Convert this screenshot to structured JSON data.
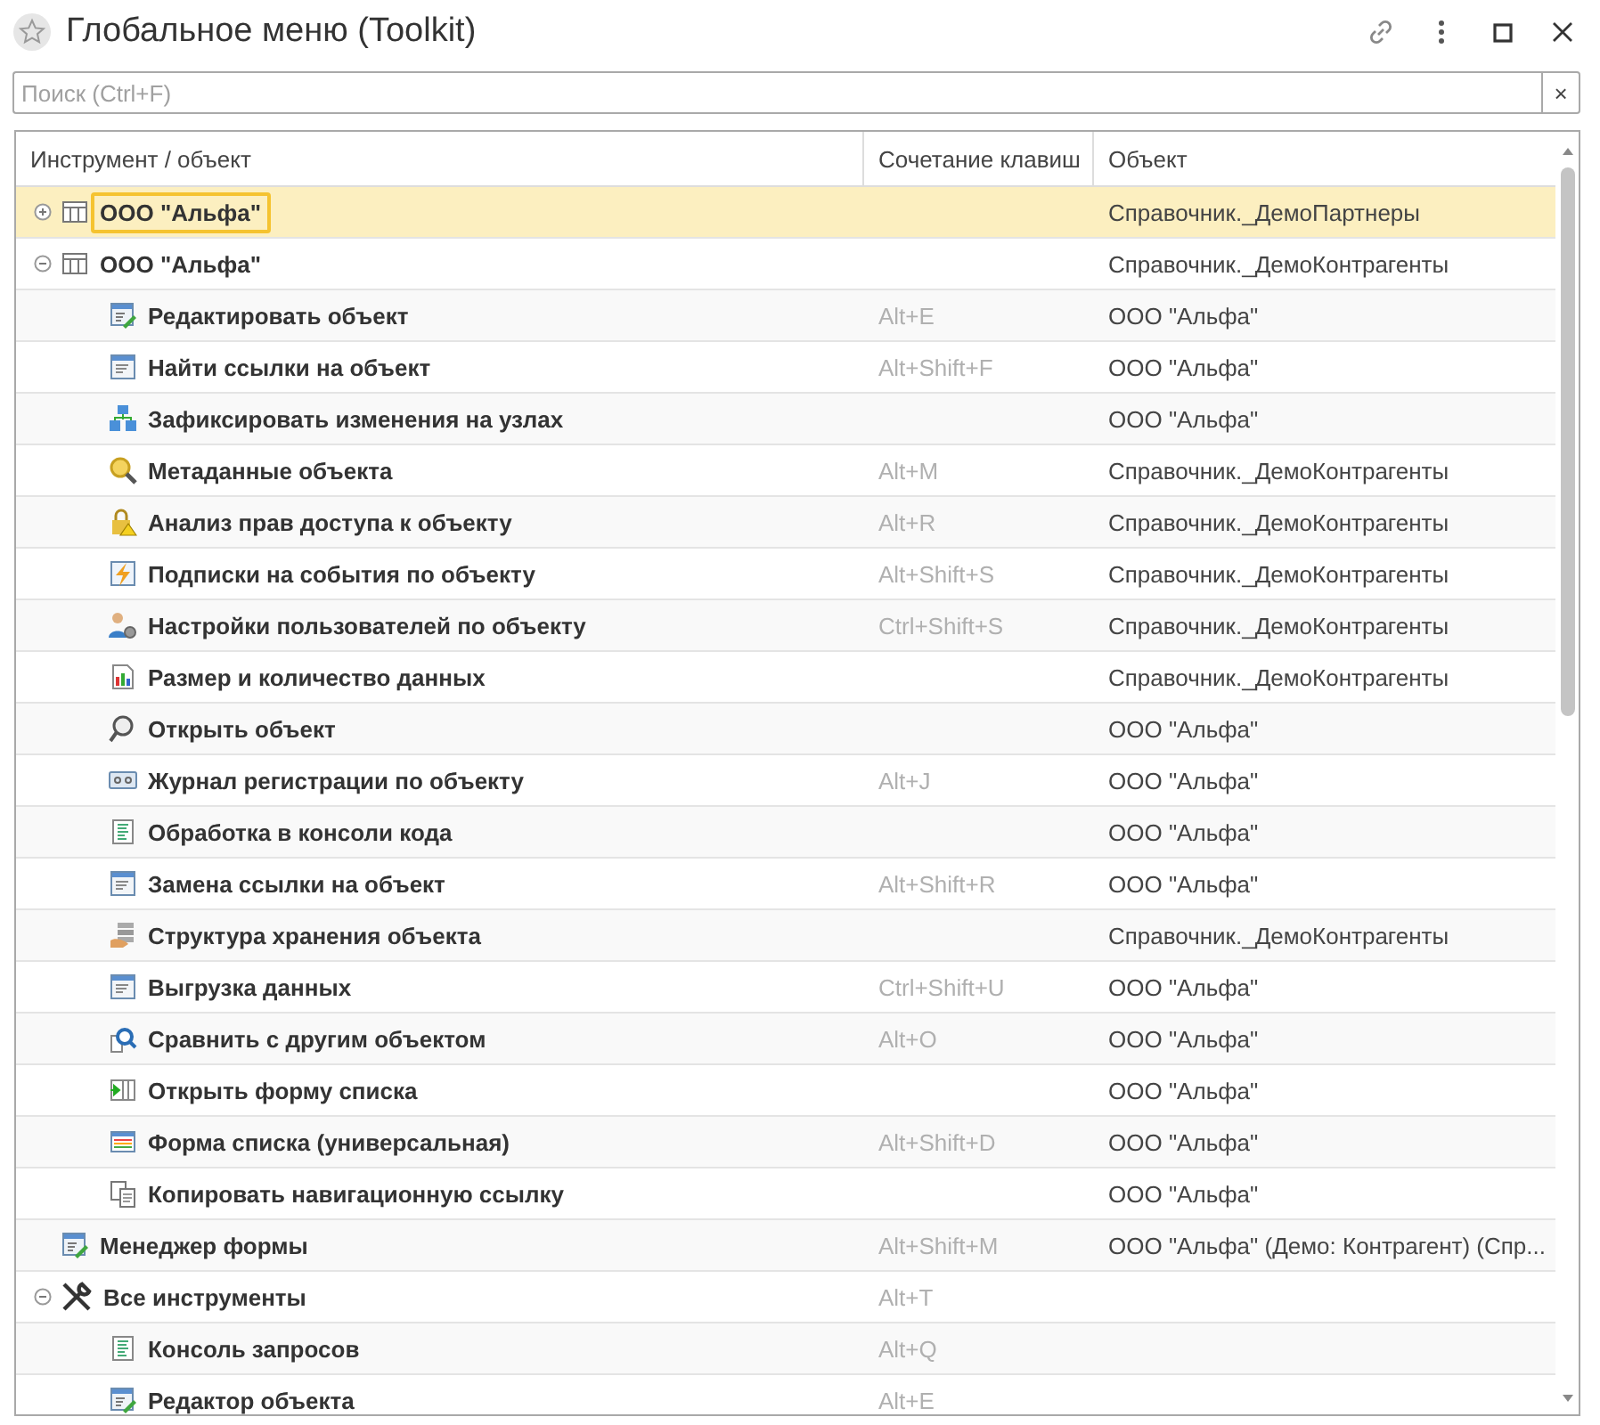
{
  "window": {
    "title": "Глобальное меню (Toolkit)"
  },
  "search": {
    "placeholder": "Поиск (Ctrl+F)",
    "clear": "×"
  },
  "table": {
    "columns": [
      "Инструмент / объект",
      "Сочетание клавиш",
      "Объект"
    ],
    "rows": [
      {
        "name": "ООО \"Альфа\"",
        "kind": "table",
        "expanded": false,
        "selected": true,
        "object": "Справочник._ДемоПартнеры"
      },
      {
        "name": "ООО \"Альфа\"",
        "kind": "table",
        "expanded": true,
        "selected": false,
        "object": "Справочник._ДемоКонтрагенты",
        "children": [
          {
            "name": "Редактировать объект",
            "kind": "edit",
            "selected": false,
            "shortcut": "Alt+E",
            "object": "ООО \"Альфа\""
          },
          {
            "name": "Найти ссылки на объект",
            "kind": "form",
            "selected": false,
            "shortcut": "Alt+Shift+F",
            "object": "ООО \"Альфа\""
          },
          {
            "name": "Зафиксировать изменения на узлах",
            "kind": "nodes",
            "selected": false,
            "object": "ООО \"Альфа\""
          },
          {
            "name": "Метаданные объекта",
            "kind": "magnifier",
            "selected": false,
            "shortcut": "Alt+M",
            "object": "Справочник._ДемоКонтрагенты"
          },
          {
            "name": "Анализ прав доступа к объекту",
            "kind": "lock",
            "selected": false,
            "shortcut": "Alt+R",
            "object": "Справочник._ДемоКонтрагенты"
          },
          {
            "name": "Подписки на события по объекту",
            "kind": "lightning",
            "selected": false,
            "shortcut": "Alt+Shift+S",
            "object": "Справочник._ДемоКонтрагенты"
          },
          {
            "name": "Настройки пользователей по объекту",
            "kind": "user",
            "selected": false,
            "shortcut": "Ctrl+Shift+S",
            "object": "Справочник._ДемоКонтрагенты"
          },
          {
            "name": "Размер и количество данных",
            "kind": "chart",
            "selected": false,
            "object": "Справочник._ДемоКонтрагенты"
          },
          {
            "name": "Открыть объект",
            "kind": "find",
            "selected": false,
            "object": "ООО \"Альфа\""
          },
          {
            "name": "Журнал регистрации по объекту",
            "kind": "log",
            "selected": false,
            "shortcut": "Alt+J",
            "object": "ООО \"Альфа\""
          },
          {
            "name": "Обработка в консоли кода",
            "kind": "doc",
            "selected": false,
            "object": "ООО \"Альфа\""
          },
          {
            "name": "Замена ссылки на объект",
            "kind": "form",
            "selected": false,
            "shortcut": "Alt+Shift+R",
            "object": "ООО \"Альфа\""
          },
          {
            "name": "Структура хранения объекта",
            "kind": "storage",
            "selected": false,
            "object": "Справочник._ДемоКонтрагенты"
          },
          {
            "name": "Выгрузка данных",
            "kind": "form",
            "selected": false,
            "shortcut": "Ctrl+Shift+U",
            "object": "ООО \"Альфа\""
          },
          {
            "name": "Сравнить с другим объектом",
            "kind": "compare",
            "selected": false,
            "shortcut": "Alt+O",
            "object": "ООО \"Альфа\""
          },
          {
            "name": "Открыть форму списка",
            "kind": "listopen",
            "selected": false,
            "object": "ООО \"Альфа\""
          },
          {
            "name": "Форма списка (универсальная)",
            "kind": "list",
            "selected": false,
            "shortcut": "Alt+Shift+D",
            "object": "ООО \"Альфа\""
          },
          {
            "name": "Копировать навигационную ссылку",
            "kind": "copy",
            "selected": false,
            "object": "ООО \"Альфа\""
          }
        ]
      },
      {
        "name": "Менеджер формы",
        "kind": "edit",
        "selected": false,
        "shortcut": "Alt+Shift+M",
        "object": "ООО \"Альфа\" (Демо: Контрагент) (Спр..."
      },
      {
        "name": "Все инструменты",
        "kind": "tools",
        "expanded": true,
        "selected": false,
        "shortcut": "Alt+T",
        "children": [
          {
            "name": "Консоль запросов",
            "kind": "doc",
            "selected": false,
            "shortcut": "Alt+Q"
          },
          {
            "name": "Редактор объекта",
            "kind": "edit",
            "selected": false,
            "shortcut": "Alt+E"
          }
        ]
      }
    ]
  }
}
